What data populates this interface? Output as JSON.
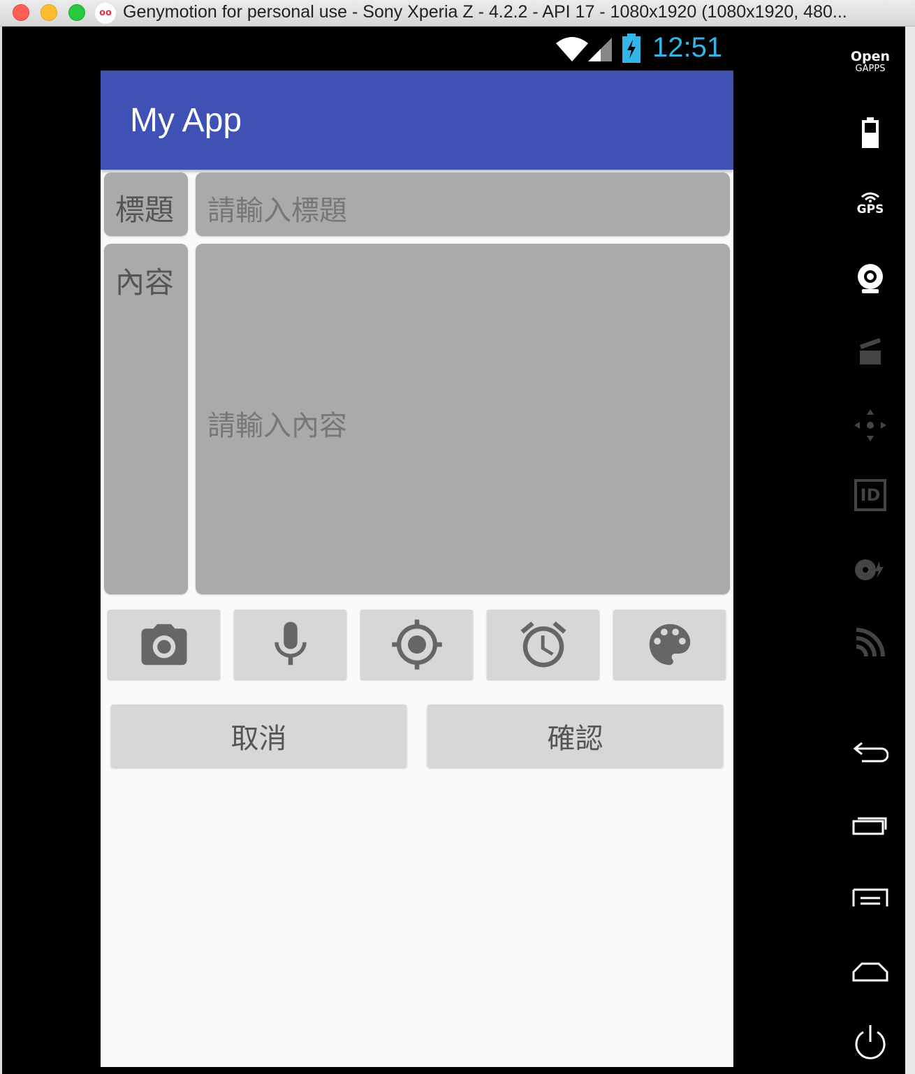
{
  "window": {
    "logo_text": "oo",
    "title": "Genymotion for personal use - Sony Xperia Z - 4.2.2 - API 17 - 1080x1920 (1080x1920, 480..."
  },
  "statusbar": {
    "time": "12:51"
  },
  "app": {
    "title": "My App"
  },
  "form": {
    "title_label": "標題",
    "title_placeholder": "請輸入標題",
    "content_label": "內容",
    "content_placeholder": "請輸入內容"
  },
  "toolbar": [
    "camera-icon",
    "microphone-icon",
    "location-icon",
    "alarm-icon",
    "palette-icon"
  ],
  "actions": {
    "cancel_label": "取消",
    "confirm_label": "確認"
  },
  "sidebar": {
    "open_label": "Open",
    "gapps_label": "GAPPS",
    "gps_label": "GPS",
    "id_label": "ID",
    "items": [
      "open-gapps",
      "battery-icon",
      "gps-icon",
      "webcam-icon",
      "media-icon",
      "dpad-icon",
      "id-icon",
      "disk-icon",
      "cast-icon",
      "back-icon",
      "recent-apps-icon",
      "menu-icon",
      "home-icon",
      "power-icon"
    ]
  }
}
